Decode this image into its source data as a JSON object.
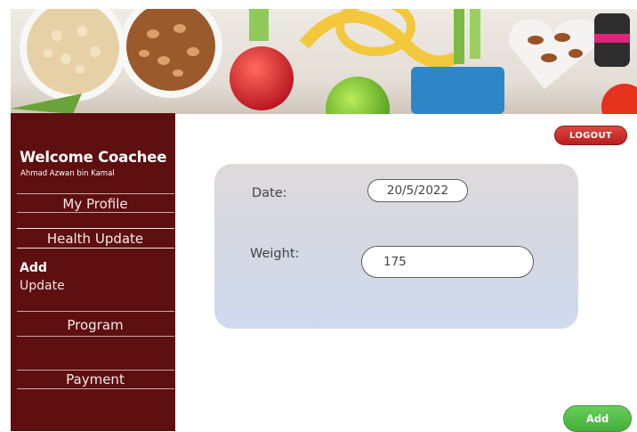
{
  "sidebar": {
    "welcome_title": "Welcome Coachee",
    "username": "Ahmad Azwan bin Kamal",
    "items": [
      {
        "label": "My Profile"
      },
      {
        "label": "Health Update"
      },
      {
        "label": "Program"
      },
      {
        "label": "Payment"
      }
    ],
    "current_section": {
      "title": "Add",
      "subtitle": "Update"
    }
  },
  "header": {
    "logout_label": "LOGOUT",
    "banner_icon": "healthy-food-banner-image"
  },
  "form": {
    "date_label": "Date:",
    "date_value": "20/5/2022",
    "weight_label": "Weight:",
    "weight_value": "175"
  },
  "actions": {
    "add_label": "Add"
  },
  "colors": {
    "sidebar": "#5e0f10",
    "logout": "#c9302c",
    "add_button": "#52bc46",
    "card_top": "#dedada",
    "card_bottom": "#cfdbee"
  }
}
